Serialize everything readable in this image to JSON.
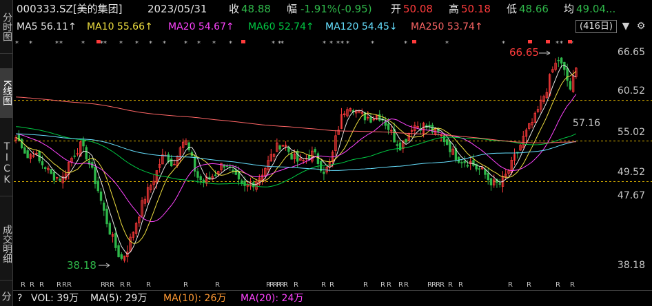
{
  "side_tabs": [
    {
      "label": "分时图",
      "active": false
    },
    {
      "label": "K线图",
      "active": true
    },
    {
      "label": "TICK",
      "active": false
    },
    {
      "label": "成交明细",
      "active": false
    },
    {
      "label": "分",
      "active": false
    }
  ],
  "header": {
    "code": "000333.SZ[美的集团]",
    "date": "2023/05/31",
    "close_label": "收",
    "close_value": "48.88",
    "change_label": "幅",
    "change_value": "-1.91%(-0.95)",
    "open_label": "开",
    "open_value": "50.08",
    "high_label": "高",
    "high_value": "50.18",
    "low_label": "低",
    "low_value": "48.66",
    "avg_label": "均",
    "avg_value": "49.04..."
  },
  "ma_line": {
    "ma5": "MA5 56.11↑",
    "ma10": "MA10 55.66↑",
    "ma20": "MA20 54.67↑",
    "ma60": "MA60 52.74↑",
    "ma120": "MA120 54.45↓",
    "ma250": "MA250 53.74↑",
    "days": "(416日)",
    "dropdown_icon": "▼",
    "settings_icon": "⚙"
  },
  "price_axis": [
    "66.65",
    "60.52",
    "57.16",
    "55.02",
    "49.52",
    "47.67",
    "38.18"
  ],
  "annotations": {
    "high": "66.65",
    "low": "38.18"
  },
  "bottom": {
    "prefix": "?",
    "vol": "VOL: 39万",
    "ma5": "MA(5): 29万",
    "ma10": "MA(10): 26万",
    "ma20": "MA(20): 24万"
  },
  "colors": {
    "up": "#ff3b3b",
    "down": "#2fb84a",
    "ma5": "#e8e8e8",
    "ma10": "#f0e040",
    "ma20": "#ff44ff",
    "ma60": "#00cc44",
    "ma120": "#66e0ff",
    "ma250": "#ff6666",
    "guide": "#d9b000"
  },
  "chart_data": {
    "type": "line",
    "guide_lines": [
      60.52,
      55.02,
      49.52
    ],
    "ylim": [
      38.18,
      66.65
    ],
    "candle_anchor_closes": [
      55.5,
      54.6,
      52.8,
      53.6,
      52.2,
      51.6,
      50.4,
      50.1,
      49.9,
      52.0,
      53.3,
      54.4,
      53.2,
      51.0,
      48.6,
      45.6,
      43.0,
      40.8,
      38.9,
      40.2,
      42.6,
      45.0,
      47.3,
      48.8,
      50.6,
      52.8,
      52.9,
      51.5,
      54.6,
      55.2,
      52.8,
      50.3,
      49.5,
      49.8,
      50.5,
      51.6,
      52.1,
      50.7,
      49.5,
      48.5,
      49.2,
      49.5,
      50.5,
      51.8,
      53.3,
      54.5,
      54.7,
      53.3,
      52.4,
      52.1,
      52.9,
      53.4,
      51.9,
      50.8,
      52.2,
      56.1,
      58.7,
      60.2,
      59.4,
      58.5,
      58.3,
      58.1,
      58.6,
      57.9,
      56.6,
      55.1,
      54.3,
      55.6,
      57.2,
      57.1,
      57.1,
      56.6,
      56.1,
      55.6,
      54.6,
      53.3,
      52.6,
      52.3,
      52.1,
      51.3,
      50.9,
      49.8,
      49.2,
      49.2,
      50.4,
      51.9,
      53.6,
      55.5,
      56.9,
      58.2,
      60.2,
      62.2,
      64.7,
      66.1,
      64.3,
      62.1,
      64.6
    ]
  }
}
